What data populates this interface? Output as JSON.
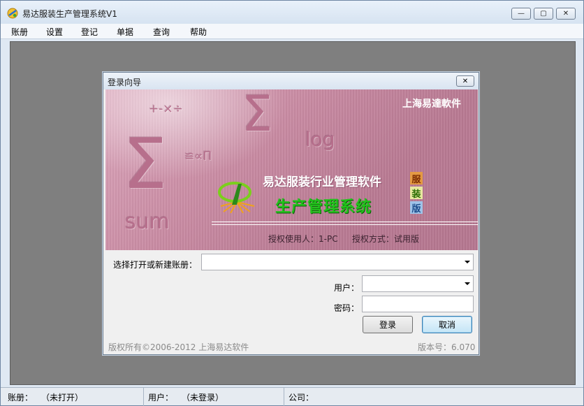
{
  "window": {
    "title": "易达服装生产管理系统V1",
    "controls": {
      "minimize": "—",
      "maximize": "▢",
      "close": "✕"
    }
  },
  "menu": [
    "账册",
    "设置",
    "登记",
    "单据",
    "查询",
    "帮助"
  ],
  "status": {
    "account_label": "账册：",
    "account_value": "（未打开）",
    "user_label": "用户：",
    "user_value": "（未登录）",
    "company_label": "公司："
  },
  "dialog": {
    "title": "登录向导",
    "close": "✕",
    "banner": {
      "company": "上海易達軟件",
      "product": "易达服装行业管理软件",
      "system": "生产管理系统",
      "badges": [
        "服",
        "装",
        "版"
      ],
      "license_user": "授权使用人：1-PC",
      "license_mode": "授权方式：试用版",
      "decor": {
        "sigma": "Σ",
        "ops": "+-×÷",
        "log": "log",
        "sym": "≌∝Π",
        "sum": "sum"
      }
    },
    "form": {
      "account_label": "选择打开或新建账册：",
      "account_value": "",
      "user_label": "用户：",
      "user_value": "",
      "password_label": "密码：",
      "password_value": "",
      "login_button": "登录",
      "cancel_button": "取消"
    },
    "footer": {
      "copyright": "版权所有©2006-2012 上海易达软件",
      "version": "版本号：6.070"
    }
  }
}
